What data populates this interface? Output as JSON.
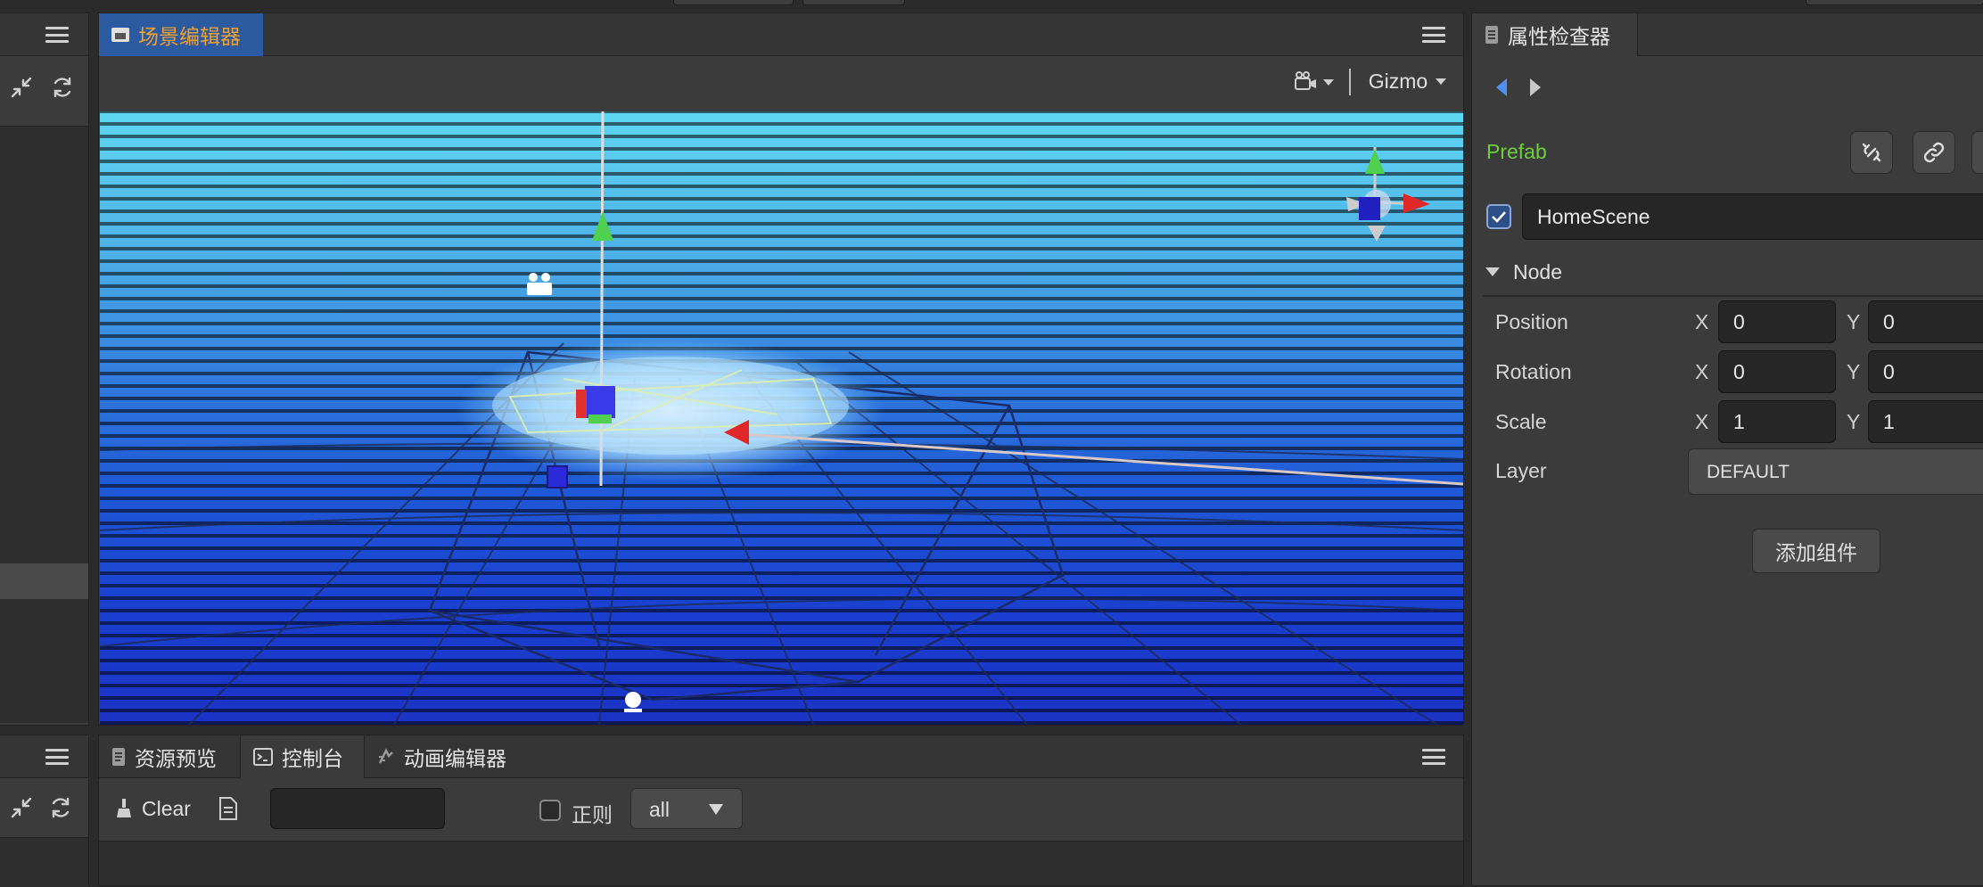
{
  "hierarchy_panel": {
    "menu_icon": "hamburger-menu-icon",
    "toolbar_icons": [
      "collapse-icon",
      "refresh-icon"
    ]
  },
  "scene_editor": {
    "tab_label": "场景编辑器",
    "tab_icon": "scene-icon",
    "camera_icon": "camera-icon",
    "gizmo_label": "Gizmo",
    "accent_color": "#f0a030"
  },
  "assets_panel": {
    "menu_icon": "hamburger-menu-icon",
    "toolbar_icons": [
      "collapse-icon",
      "refresh-icon"
    ]
  },
  "bottom_panel": {
    "tabs": [
      {
        "label": "资源预览",
        "icon": "document-icon"
      },
      {
        "label": "控制台",
        "icon": "terminal-icon"
      },
      {
        "label": "动画编辑器",
        "icon": "animation-icon"
      }
    ],
    "active_tab": "控制台",
    "console": {
      "clear_label": "Clear",
      "search_value": "",
      "regex_label": "正则",
      "regex_checked": false,
      "filter_value": "all"
    }
  },
  "inspector": {
    "tab_label": "属性检查器",
    "tab_icon": "inspector-icon",
    "prefab_label": "Prefab",
    "prefab_color": "#6fcf3b",
    "node_active": true,
    "node_name": "HomeScene",
    "section_title": "Node",
    "properties": {
      "position": {
        "label": "Position",
        "x_label": "X",
        "x": "0",
        "y_label": "Y",
        "y": "0"
      },
      "rotation": {
        "label": "Rotation",
        "x_label": "X",
        "x": "0",
        "y_label": "Y",
        "y": "0"
      },
      "scale": {
        "label": "Scale",
        "x_label": "X",
        "x": "1",
        "y_label": "Y",
        "y": "1"
      },
      "layer": {
        "label": "Layer",
        "value": "DEFAULT"
      }
    },
    "add_component_label": "添加组件"
  }
}
